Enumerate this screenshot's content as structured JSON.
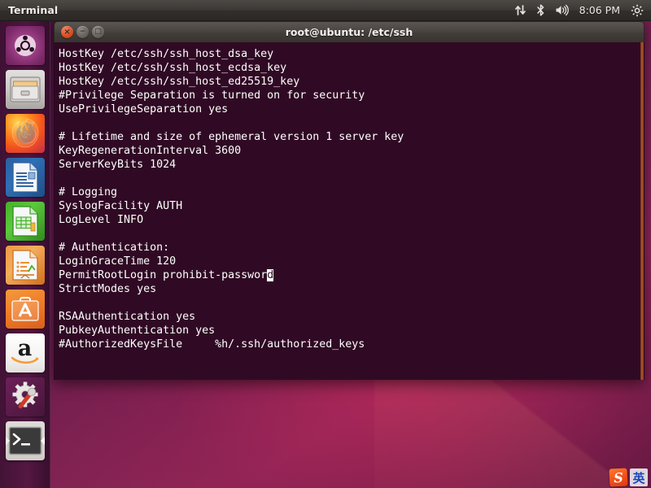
{
  "panel": {
    "app_name": "Terminal",
    "clock": "8:06 PM",
    "tray_icons": [
      {
        "name": "network-icon",
        "label": "network"
      },
      {
        "name": "bluetooth-icon",
        "label": "bluetooth"
      },
      {
        "name": "volume-icon",
        "label": "volume"
      },
      {
        "name": "system-menu-icon",
        "label": "system menu"
      }
    ]
  },
  "launcher": {
    "items": [
      {
        "name": "ubuntu-dash",
        "label": "Dash Home",
        "active": false
      },
      {
        "name": "files",
        "label": "Files",
        "active": false
      },
      {
        "name": "firefox",
        "label": "Firefox Web Browser",
        "active": false
      },
      {
        "name": "libreoffice-writer",
        "label": "LibreOffice Writer",
        "active": false
      },
      {
        "name": "libreoffice-calc",
        "label": "LibreOffice Calc",
        "active": false
      },
      {
        "name": "libreoffice-impress",
        "label": "LibreOffice Impress",
        "active": false
      },
      {
        "name": "ubuntu-software",
        "label": "Ubuntu Software",
        "active": false
      },
      {
        "name": "amazon",
        "label": "Amazon",
        "active": false
      },
      {
        "name": "system-settings",
        "label": "System Settings",
        "active": false
      },
      {
        "name": "terminal",
        "label": "Terminal",
        "active": true
      }
    ]
  },
  "terminal": {
    "title": "root@ubuntu: /etc/ssh",
    "buttons": {
      "close": "×",
      "minimize": "−",
      "maximize": "□"
    },
    "background_color": "#300a24",
    "text_color": "#ffffff",
    "lines": [
      "HostKey /etc/ssh/ssh_host_dsa_key",
      "HostKey /etc/ssh/ssh_host_ecdsa_key",
      "HostKey /etc/ssh/ssh_host_ed25519_key",
      "#Privilege Separation is turned on for security",
      "UsePrivilegeSeparation yes",
      "",
      "# Lifetime and size of ephemeral version 1 server key",
      "KeyRegenerationInterval 3600",
      "ServerKeyBits 1024",
      "",
      "# Logging",
      "SyslogFacility AUTH",
      "LogLevel INFO",
      "",
      "# Authentication:",
      "LoginGraceTime 120",
      "StrictModes yes",
      "",
      "RSAAuthentication yes",
      "PubkeyAuthentication yes",
      "#AuthorizedKeysFile     %h/.ssh/authorized_keys"
    ],
    "cursor_line": {
      "index": 16,
      "before": "PermitRootLogin prohibit-passwor",
      "cursor_char": "d",
      "after": ""
    }
  },
  "ime": {
    "logo_text": "S",
    "mode_char": "英"
  },
  "colors": {
    "panel_bg": "#3d3a36",
    "launcher_bg": "#50164 2",
    "terminal_bg": "#300a24",
    "desktop_accent": "#8e2657",
    "close_button": "#df542b"
  }
}
